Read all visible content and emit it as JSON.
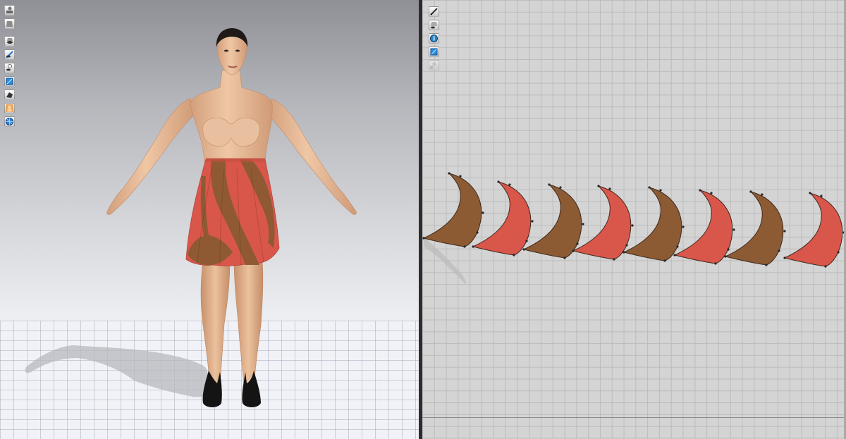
{
  "colors": {
    "brown": "#8c5a33",
    "red": "#d9564a",
    "skin": "#e3b792",
    "hair": "#1f1a17",
    "pattern_stroke": "#3e2a1e",
    "pattern_point": "#262626"
  },
  "toolbar_3d": {
    "icons": [
      "display-avatar-icon",
      "garment-display-icon",
      "show-avatar-icon",
      "show-pattern-icon",
      "show-pin-icon",
      "texture-display-icon",
      "rendering-icon",
      "avatar-skin-icon",
      "mesh-display-icon"
    ]
  },
  "toolbar_2d": {
    "icons": [
      "edit-pattern-icon",
      "show-garment-icon",
      "information-icon",
      "texture-view-icon",
      "arrangement-icon"
    ]
  },
  "pattern_pieces": [
    {
      "fill": "brown"
    },
    {
      "fill": "red"
    },
    {
      "fill": "brown"
    },
    {
      "fill": "red"
    },
    {
      "fill": "brown"
    },
    {
      "fill": "red"
    },
    {
      "fill": "brown"
    },
    {
      "fill": "red"
    }
  ]
}
